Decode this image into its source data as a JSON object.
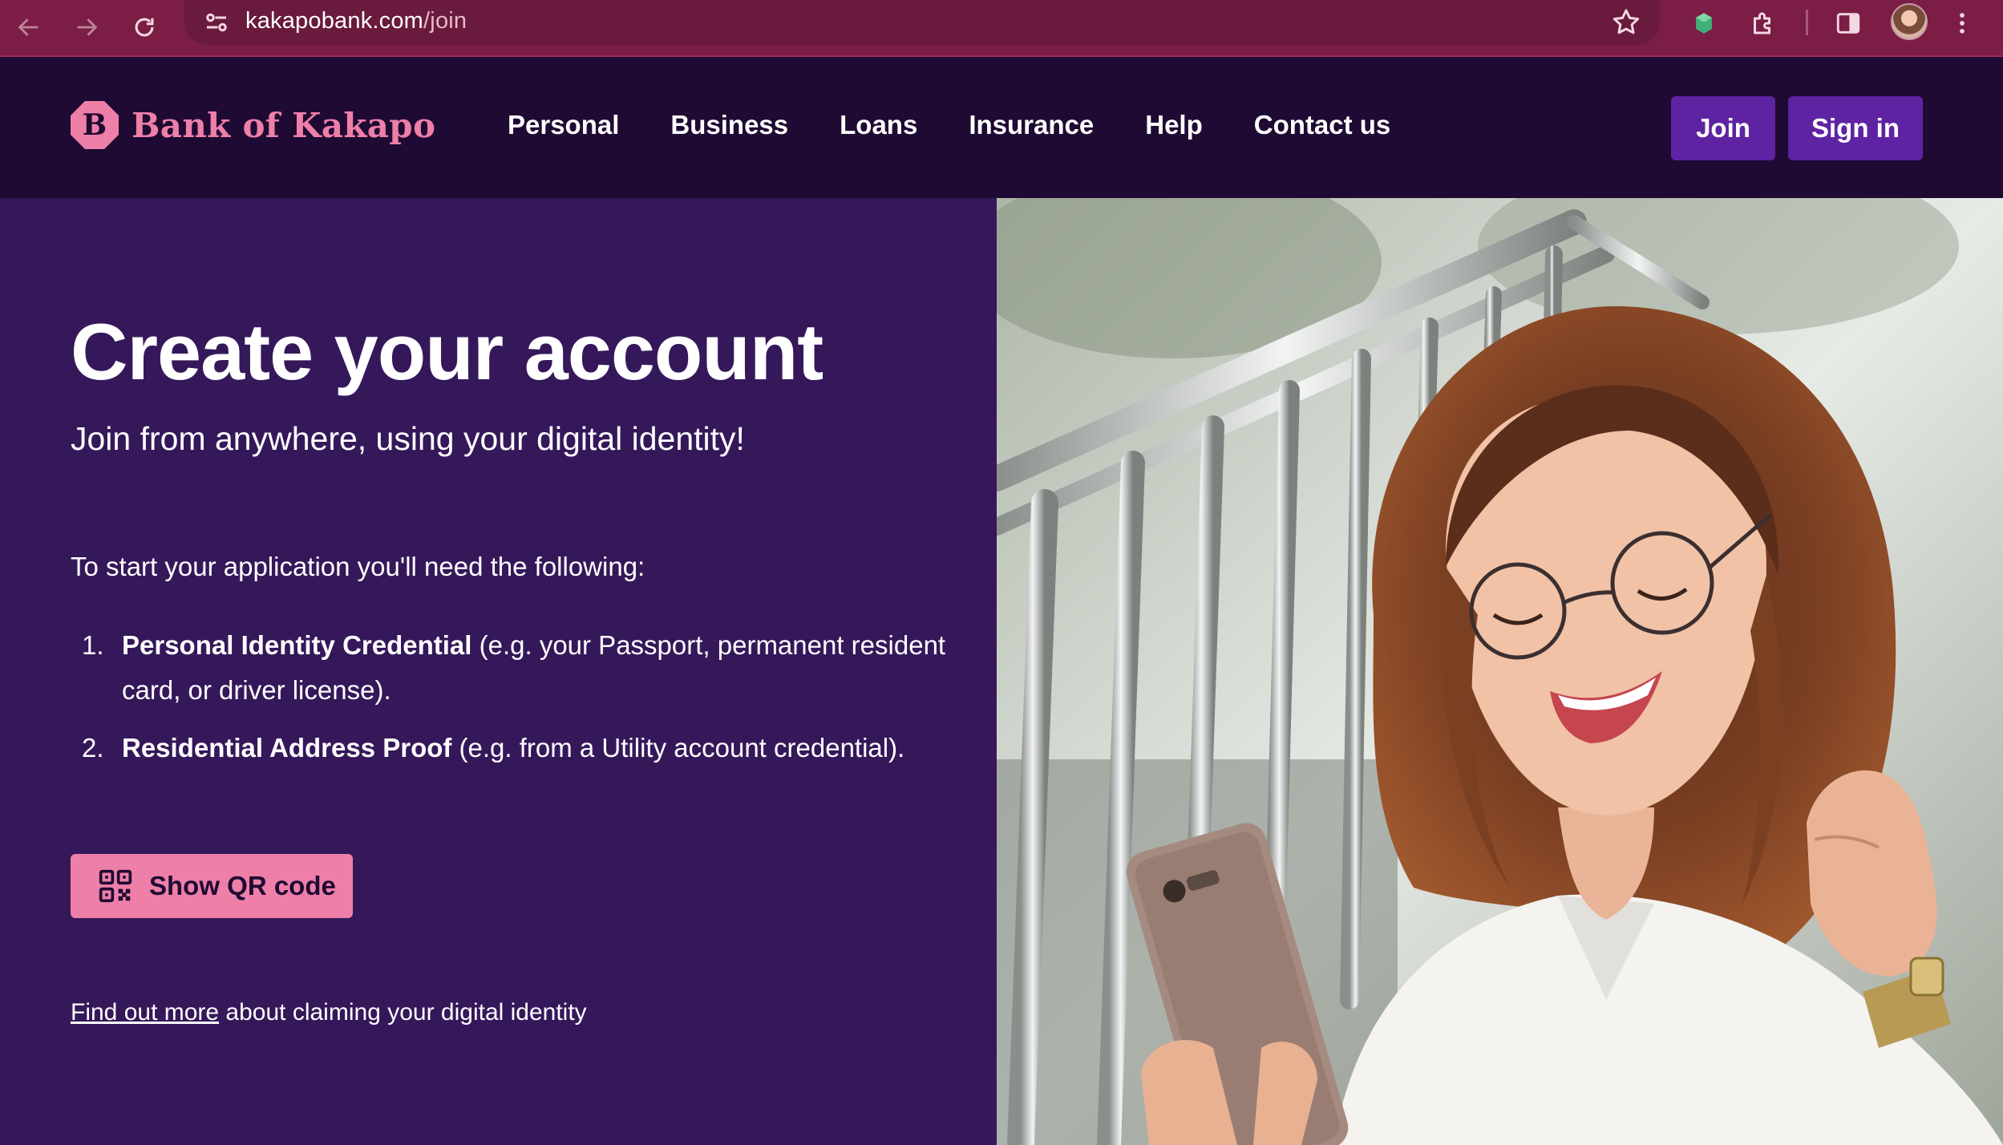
{
  "browser": {
    "url_host": "kakapobank.com",
    "url_path": "/join"
  },
  "header": {
    "logo_letter": "B",
    "brand": "Bank of Kakapo",
    "nav": [
      "Personal",
      "Business",
      "Loans",
      "Insurance",
      "Help",
      "Contact us"
    ],
    "join_label": "Join",
    "signin_label": "Sign in"
  },
  "hero": {
    "title": "Create your account",
    "subtitle": "Join from anywhere, using your digital identity!",
    "intro": "To start your application you'll need the following:",
    "requirements": [
      {
        "num": "1.",
        "bold": "Personal Identity Credential",
        "rest": " (e.g. your Passport, permanent resident card, or driver license)."
      },
      {
        "num": "2.",
        "bold": "Residential Address Proof",
        "rest": " (e.g. from a Utility account credential)."
      }
    ],
    "qr_button_label": "Show QR code",
    "find_more_link": "Find out more",
    "find_more_rest": " about claiming your digital identity"
  },
  "colors": {
    "chrome": "#7b1d45",
    "header_bg": "#1f0a33",
    "panel_bg": "#35185a",
    "accent_pink": "#ee7fa8",
    "button_purple": "#5e23a3"
  },
  "icons": [
    "back-arrow-icon",
    "forward-arrow-icon",
    "reload-icon",
    "site-settings-icon",
    "bookmark-star-icon",
    "extension-icon",
    "puzzle-icon",
    "side-panel-icon",
    "menu-dots-icon",
    "qr-code-icon"
  ]
}
